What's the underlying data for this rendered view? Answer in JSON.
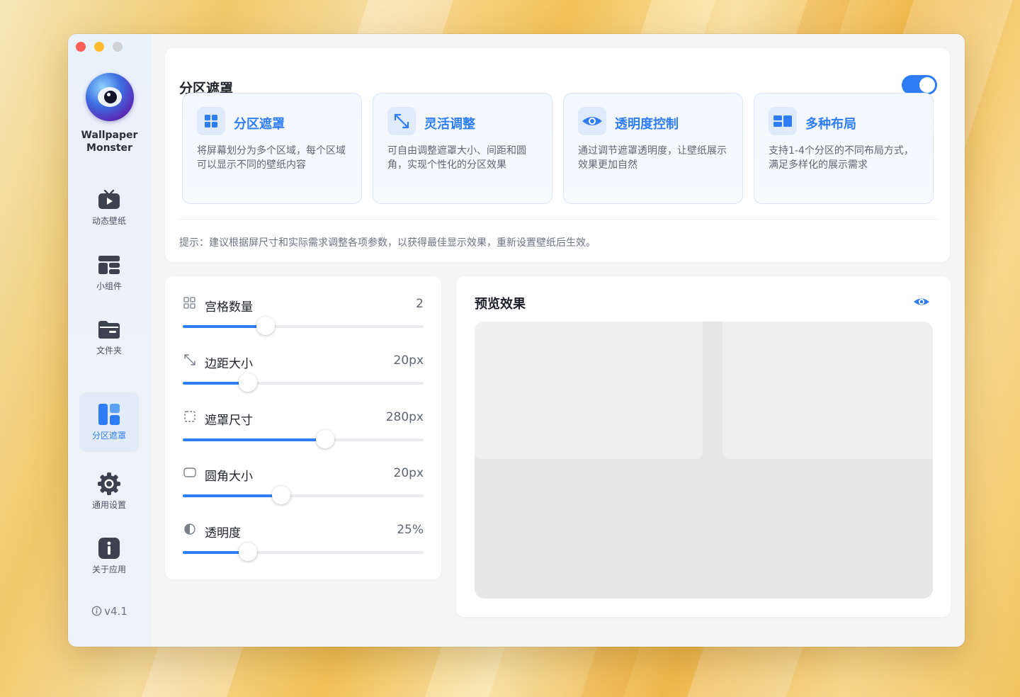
{
  "app": {
    "name": "Wallpaper Monster",
    "version": "v4.1"
  },
  "sidebar": {
    "items": [
      {
        "label": "动态壁纸",
        "icon": "tv-play-icon"
      },
      {
        "label": "小组件",
        "icon": "widget-icon"
      },
      {
        "label": "文件夹",
        "icon": "folder-icon"
      },
      {
        "label": "分区遮罩",
        "icon": "layout-icon",
        "active": true
      },
      {
        "label": "通用设置",
        "icon": "gear-icon"
      },
      {
        "label": "关于应用",
        "icon": "info-icon"
      }
    ]
  },
  "header": {
    "title": "分区遮罩",
    "enabled": true
  },
  "features": [
    {
      "title": "分区遮罩",
      "desc": "将屏幕划分为多个区域，每个区域可以显示不同的壁纸内容",
      "icon": "grid-icon"
    },
    {
      "title": "灵活调整",
      "desc": "可自由调整遮罩大小、间距和圆角，实现个性化的分区效果",
      "icon": "resize-icon"
    },
    {
      "title": "透明度控制",
      "desc": "通过调节遮罩透明度，让壁纸展示效果更加自然",
      "icon": "eye-icon"
    },
    {
      "title": "多种布局",
      "desc": "支持1-4个分区的不同布局方式，满足多样化的展示需求",
      "icon": "layout-icon"
    }
  ],
  "tip": "提示：建议根据屏尺寸和实际需求调整各项参数，以获得最佳显示效果，重新设置壁纸后生效。",
  "controls": [
    {
      "label": "宫格数量",
      "value": "2",
      "icon": "grid-outline-icon",
      "level": 0.345
    },
    {
      "label": "边距大小",
      "value": "20px",
      "icon": "resize-arrows-icon",
      "level": 0.27
    },
    {
      "label": "遮罩尺寸",
      "value": "280px",
      "icon": "dashed-square-icon",
      "level": 0.59
    },
    {
      "label": "圆角大小",
      "value": "20px",
      "icon": "rounded-rect-icon",
      "level": 0.41
    },
    {
      "label": "透明度",
      "value": "25%",
      "icon": "contrast-icon",
      "level": 0.27
    }
  ],
  "preview": {
    "title": "预览效果",
    "icon": "eye-icon"
  },
  "colors": {
    "accent": "#2f7df6",
    "close": "#ff5f57",
    "minimize": "#febc2e",
    "zoom_disabled": "#d0d2d6"
  }
}
